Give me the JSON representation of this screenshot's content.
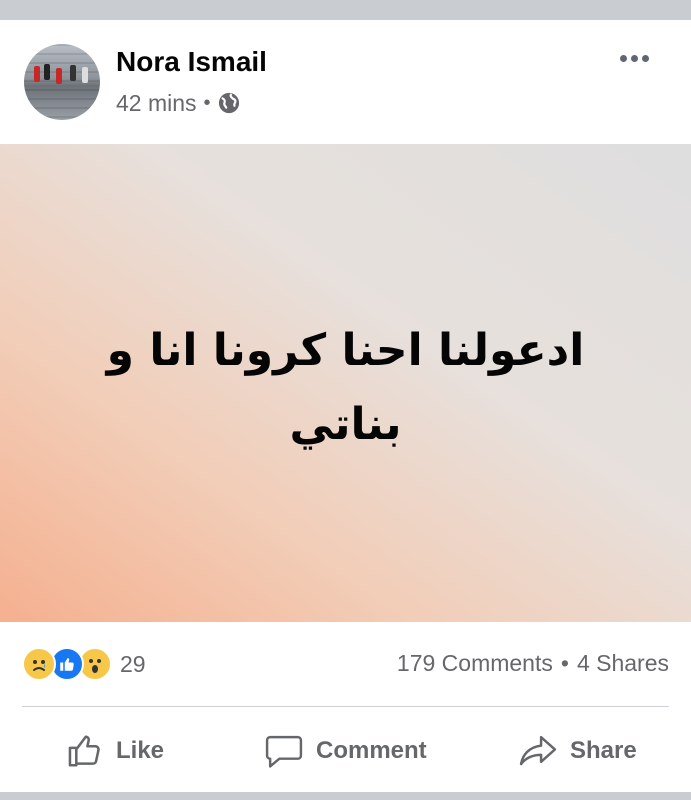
{
  "post": {
    "author": "Nora Ismail",
    "time": "42 mins",
    "separator": "•",
    "privacy_icon": "globe-icon",
    "menu_icon": "more-dots-icon",
    "status_text": "ادعولنا احنا كرونا انا و بناتي",
    "background_colors": [
      "#f5b08f",
      "#dedede"
    ]
  },
  "engagement": {
    "reaction_icons": [
      "sad-reaction-icon",
      "like-reaction-icon",
      "wow-reaction-icon"
    ],
    "reaction_count": "29",
    "comments": "179 Comments",
    "separator": "•",
    "shares": "4 Shares"
  },
  "actions": {
    "like_label": "Like",
    "comment_label": "Comment",
    "share_label": "Share"
  },
  "colors": {
    "text_primary": "#050505",
    "text_secondary": "#65676b",
    "like_blue": "#1877f2",
    "divider": "#ced0d4"
  }
}
